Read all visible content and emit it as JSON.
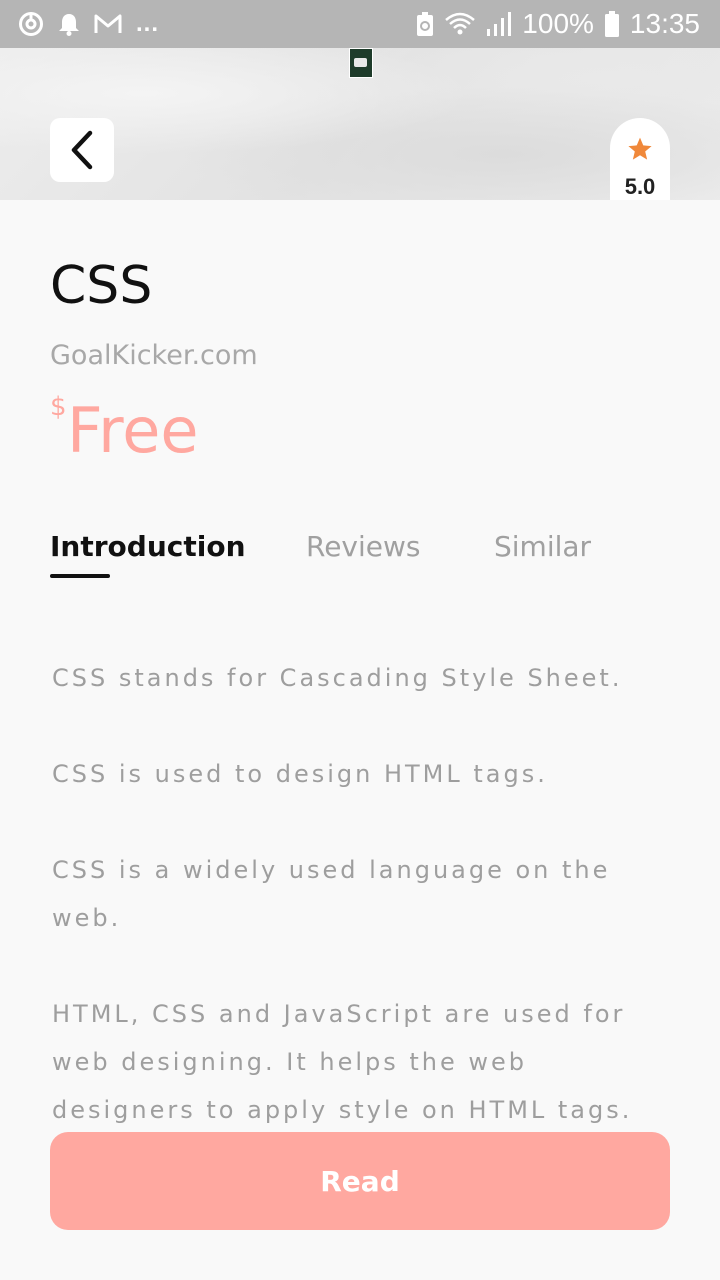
{
  "status_bar": {
    "battery_percent": "100%",
    "time": "13:35",
    "overflow": "...",
    "icons": [
      "sync-icon",
      "bell-icon",
      "gmail-icon",
      "battery-saver-icon",
      "wifi-icon",
      "signal-icon",
      "battery-icon"
    ]
  },
  "header": {
    "rating": "5.0",
    "rating_icon": "star-icon",
    "back_icon": "chevron-left-icon"
  },
  "book": {
    "title": "CSS",
    "author": "GoalKicker.com",
    "currency": "$",
    "price": "Free"
  },
  "tabs": [
    {
      "label": "Introduction",
      "active": true
    },
    {
      "label": "Reviews",
      "active": false
    },
    {
      "label": "Similar",
      "active": false
    }
  ],
  "introduction": [
    "CSS stands for Cascading Style Sheet.",
    "CSS is used to design HTML tags.",
    "CSS is a widely used language on the web.",
    "HTML, CSS and JavaScript are used for web designing. It helps the web designers to apply style on HTML tags."
  ],
  "actions": {
    "read_label": "Read"
  },
  "colors": {
    "accent": "#ffa8a0",
    "star": "#f0883a",
    "status_bar": "#b5b5b5"
  }
}
